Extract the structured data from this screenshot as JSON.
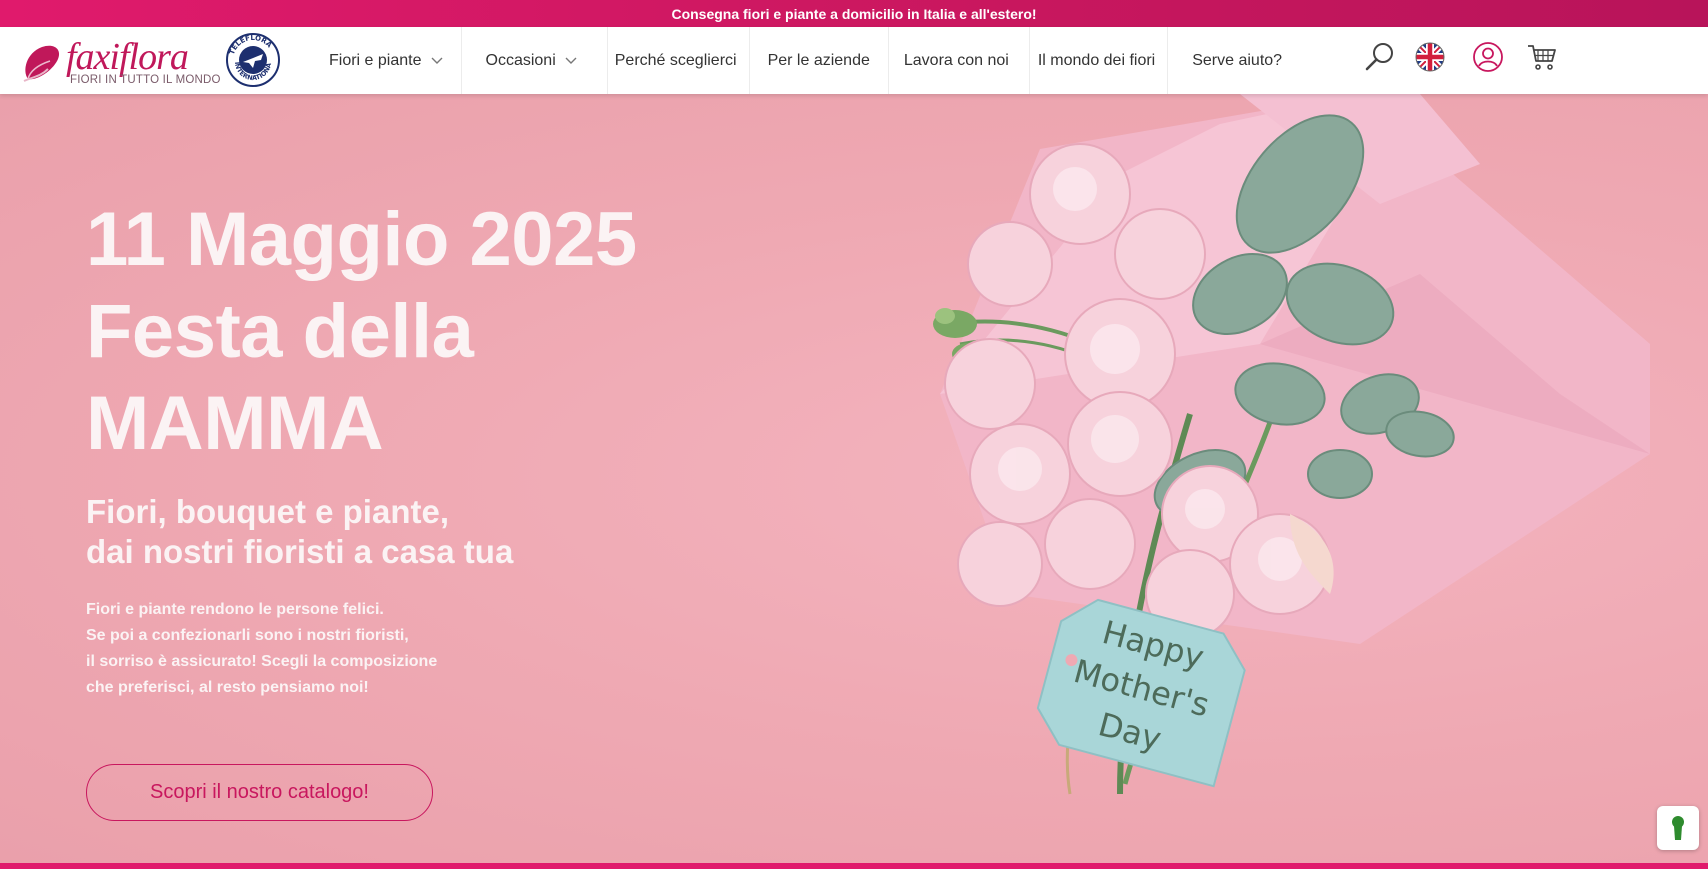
{
  "topbar": {
    "text": "Consegna fiori e piante a domicilio in Italia e all'estero!"
  },
  "brand": {
    "name": "faxiflora",
    "tagline": "FIORI IN TUTTO IL MONDO",
    "partner_badge": "TELEFLORA INTERNATIONAL",
    "color": "#c0185a"
  },
  "nav": {
    "items": [
      {
        "label": "Fiori e piante",
        "has_dropdown": true
      },
      {
        "label": "Occasioni",
        "has_dropdown": true
      },
      {
        "label": "Perché sceglierci",
        "has_dropdown": false
      },
      {
        "label": "Per le aziende",
        "has_dropdown": false
      },
      {
        "label": "Lavora con noi",
        "has_dropdown": false
      },
      {
        "label": "Il mondo dei fiori",
        "has_dropdown": false
      },
      {
        "label": "Serve aiuto?",
        "has_dropdown": false
      }
    ],
    "icons": [
      "search-icon",
      "uk-flag-icon",
      "user-account-icon",
      "cart-icon"
    ]
  },
  "hero": {
    "title_line1": "11 Maggio 2025",
    "title_line2": "Festa della",
    "title_line3": "MAMMA",
    "subtitle_line1": "Fiori, bouquet e piante,",
    "subtitle_line2": "dai nostri fioristi a casa tua",
    "body": [
      "Fiori e piante rendono le persone felici.",
      "Se poi a confezionarli sono i nostri fioristi,",
      "il sorriso è assicurato! Scegli la composizione",
      "che preferisci, al resto pensiamo noi!"
    ],
    "cta_label": "Scopri il nostro catalogo!",
    "tag_text_line1": "Happy",
    "tag_text_line2": "Mother's",
    "tag_text_line3": "Day"
  },
  "colors": {
    "accent": "#e01a6c",
    "cta": "#c8175e",
    "hero_bg": "#efaab4"
  }
}
